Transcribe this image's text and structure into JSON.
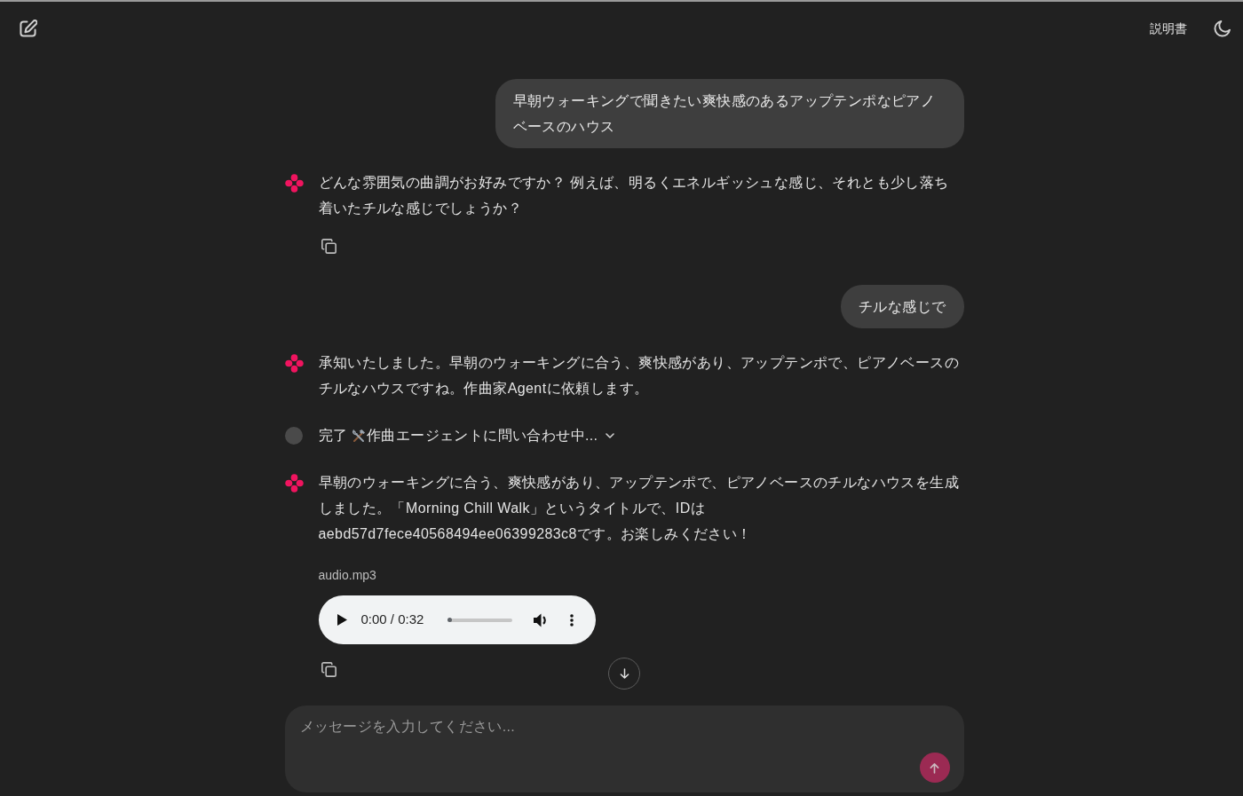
{
  "header": {
    "manual_link": "説明書"
  },
  "messages": [
    {
      "kind": "user",
      "text": "早朝ウォーキングで聞きたい爽快感のあるアップテンポなピアノベースのハウス"
    },
    {
      "kind": "assistant",
      "text": "どんな雰囲気の曲調がお好みですか？ 例えば、明るくエネルギッシュな感じ、それとも少し落ち着いたチルな感じでしょうか？",
      "copy": true
    },
    {
      "kind": "user",
      "text": "チルな感じで"
    },
    {
      "kind": "assistant",
      "text": "承知いたしました。早朝のウォーキングに合う、爽快感があり、アップテンポで、ピアノベースのチルなハウスですね。作曲家Agentに依頼します。",
      "copy": false
    },
    {
      "kind": "status",
      "label": "完了",
      "text": "作曲エージェントに問い合わせ中...",
      "expanded": false
    },
    {
      "kind": "assistant",
      "text": "早朝のウォーキングに合う、爽快感があり、アップテンポで、ピアノベースのチルなハウスを生成しました。「Morning Chill Walk」というタイトルで、IDはaebd57d7fece40568494ee06399283c8です。お楽しみください！",
      "copy": true,
      "attachment": {
        "filename": "audio.mp3",
        "time": "0:00 / 0:32",
        "level": 0
      }
    }
  ],
  "composer": {
    "placeholder": "メッセージを入力してください..."
  }
}
